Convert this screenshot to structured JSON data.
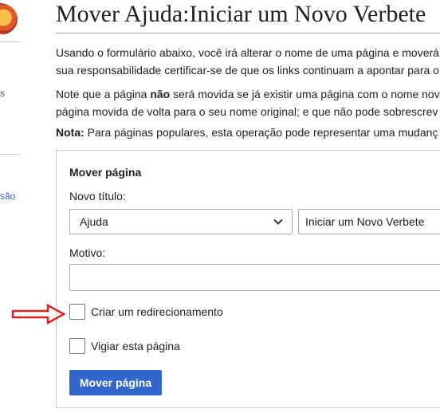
{
  "sidebar": {
    "logo_icon": "wiki-globe-logo",
    "tick": "s",
    "link": "são"
  },
  "page": {
    "title": "Mover Ajuda:Iniciar um Novo Verbete"
  },
  "intro": {
    "p1_line1": "Usando o formulário abaixo, você irá alterar o nome de uma página e moverá",
    "p1_line2": "sua responsabilidade certificar-se de que os links continuam a apontar para o",
    "p2_pre": "Note que a página ",
    "p2_bold": "não",
    "p2_post": " será movida se já existir uma página com o nome nov",
    "p2_line2": "página movida de volta para o seu nome original; e que não pode sobrescrev",
    "p3_bold": "Nota:",
    "p3_text": " Para páginas populares, esta operação pode representar uma mudanç"
  },
  "form": {
    "legend": "Mover página",
    "new_title_label": "Novo título:",
    "namespace_value": "Ajuda",
    "title_value": "Iniciar um Novo Verbete",
    "reason_label": "Motivo:",
    "reason_value": "",
    "redirect_label": "Criar um redirecionamento",
    "redirect_checked": false,
    "watch_label": "Vigiar esta página",
    "watch_checked": false,
    "submit_label": "Mover página"
  },
  "annotation": {
    "arrow_icon": "red-arrow-icon",
    "arrow_color": "#e02020"
  },
  "colors": {
    "accent": "#3366cc",
    "link": "#3366cc",
    "border": "#a2a9b1"
  }
}
